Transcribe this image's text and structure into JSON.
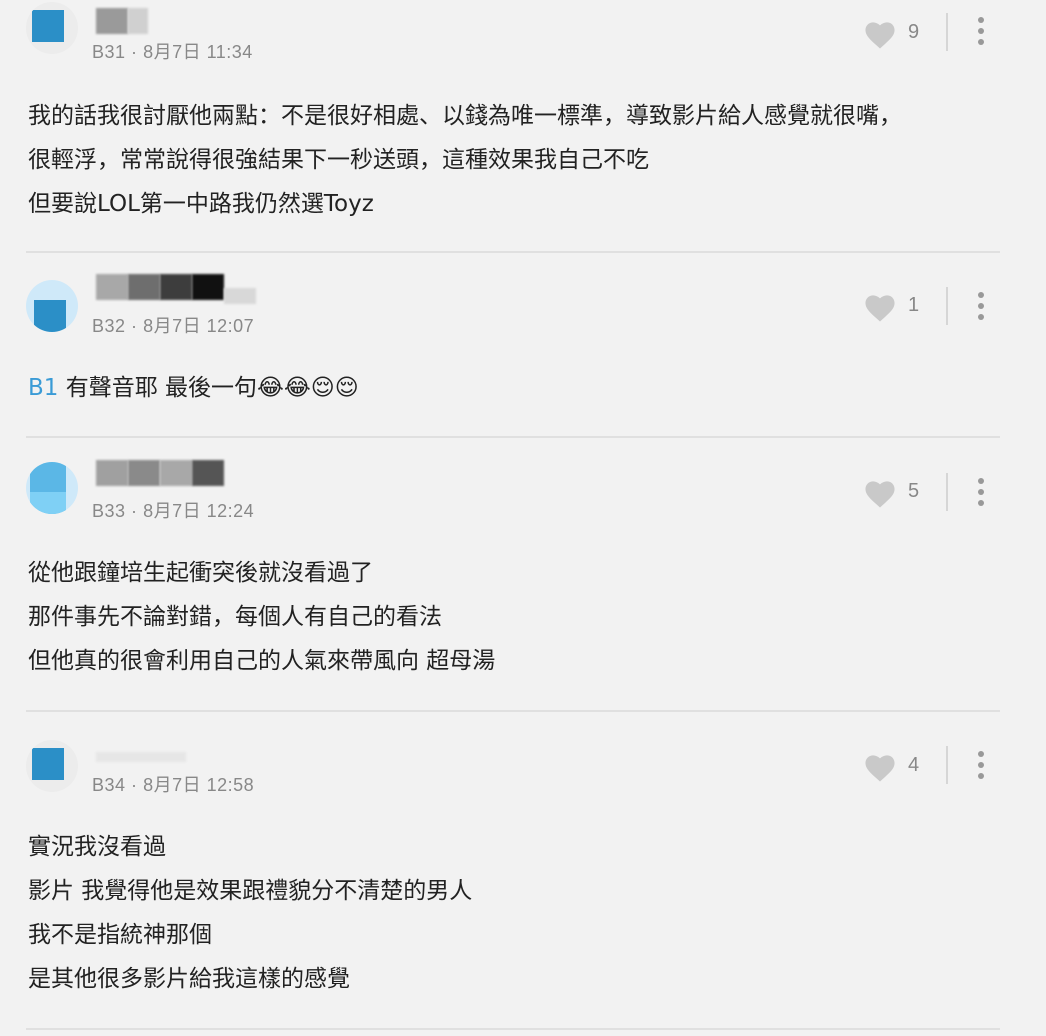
{
  "comments": [
    {
      "floor": "B31",
      "date": "8月7日 11:34",
      "likes": "9",
      "lines": [
        "我的話我很討厭他兩點：不是很好相處、以錢為唯一標準，導致影片給人感覺就很嘴，",
        "很輕浮，常常說得很強結果下一秒送頭，這種效果我自己不吃",
        "但要說LOL第一中路我仍然選Toyz"
      ]
    },
    {
      "floor": "B32",
      "date": "8月7日 12:07",
      "likes": "1",
      "tag": "B1",
      "text": "有聲音耶 最後一句😂😂😌😌"
    },
    {
      "floor": "B33",
      "date": "8月7日 12:24",
      "likes": "5",
      "lines": [
        "從他跟鐘培生起衝突後就沒看過了",
        "那件事先不論對錯，每個人有自己的看法",
        "但他真的很會利用自己的人氣來帶風向 超母湯"
      ]
    },
    {
      "floor": "B34",
      "date": "8月7日 12:58",
      "likes": "4",
      "lines": [
        "實況我沒看過",
        "影片 我覺得他是效果跟禮貌分不清楚的男人",
        "我不是指統神那個",
        "是其他很多影片給我這樣的感覺"
      ]
    }
  ],
  "meta_separator": "·",
  "colors": {
    "background": "#f2f2f2",
    "mention": "#3a9bd6",
    "meta": "#888888",
    "avatar": "#2b8fc7"
  },
  "icons": {
    "like": "heart-icon",
    "more": "more-vertical-icon"
  }
}
